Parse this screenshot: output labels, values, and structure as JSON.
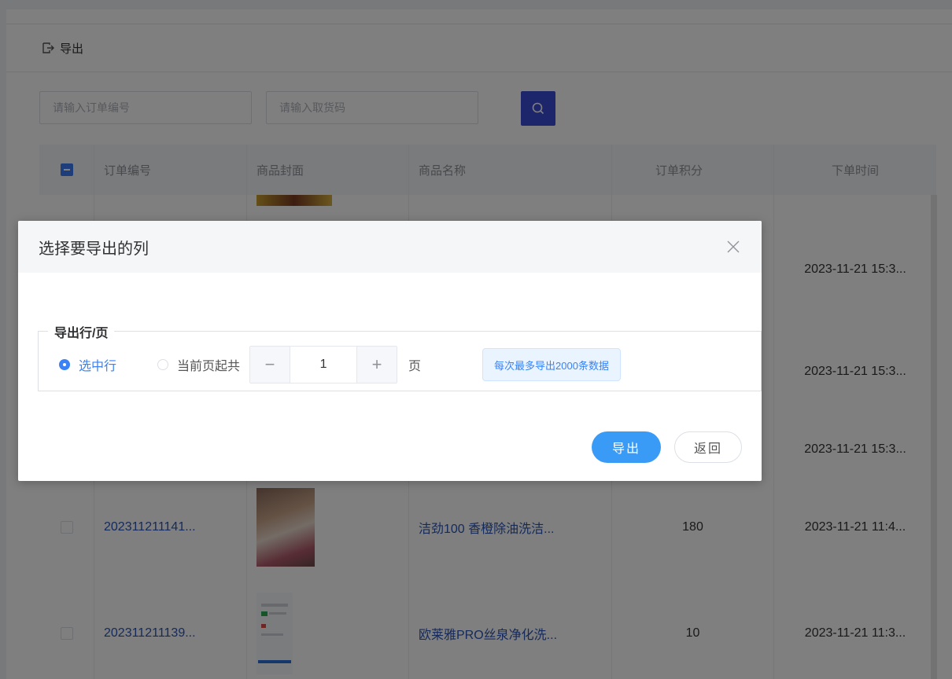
{
  "toolbar": {
    "export_label": "导出"
  },
  "search": {
    "order_placeholder": "请输入订单编号",
    "pickup_placeholder": "请输入取货码"
  },
  "table": {
    "headers": {
      "order_no": "订单编号",
      "cover": "商品封面",
      "name": "商品名称",
      "points": "订单积分",
      "time": "下单时间"
    },
    "rows": [
      {
        "order_no": "",
        "name": "",
        "points": "",
        "time": "2023-11-21 15:3..."
      },
      {
        "order_no": "",
        "name": "",
        "points": "",
        "time": "2023-11-21 15:3..."
      },
      {
        "order_no": "",
        "name": "",
        "points": "",
        "time": "2023-11-21 15:3..."
      },
      {
        "order_no": "202311211141...",
        "name": "洁劲100 香橙除油洗洁...",
        "points": "180",
        "time": "2023-11-21 11:4..."
      },
      {
        "order_no": "202311211139...",
        "name": "欧莱雅PRO丝泉净化洗...",
        "points": "10",
        "time": "2023-11-21 11:3..."
      }
    ]
  },
  "dialog": {
    "title": "选择要导出的列",
    "fieldset_legend": "导出行/页",
    "radio_selected_label": "选中行",
    "radio_from_current_label": "当前页起共",
    "page_count_value": "1",
    "minus_label": "−",
    "plus_label": "+",
    "page_unit": "页",
    "tip": "每次最多导出2000条数据",
    "confirm_label": "导出",
    "cancel_label": "返回"
  },
  "colors": {
    "primary": "#3a9bf6",
    "search_button": "#3a4bd6",
    "link": "#2b55b6",
    "overlay": "rgba(0,0,0,0.5)"
  }
}
